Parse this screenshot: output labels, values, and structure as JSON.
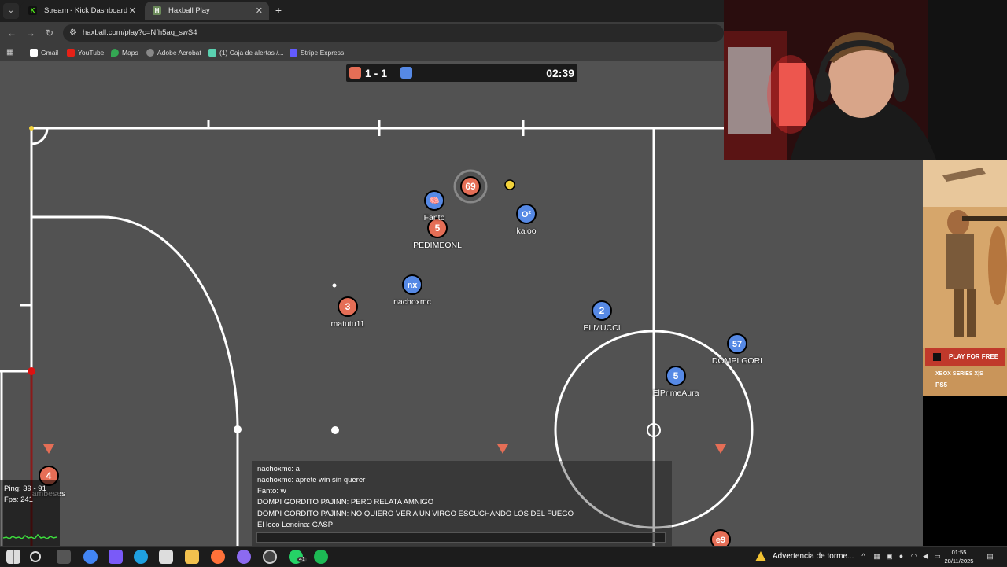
{
  "browser": {
    "tabs": [
      {
        "title": "Stream - Kick Dashboard",
        "icon": "kick-icon",
        "active": false
      },
      {
        "title": "Haxball Play",
        "icon": "haxball-icon",
        "active": true
      }
    ],
    "address": "haxball.com/play?c=Nfh5aq_swS4",
    "bookmarks": [
      "Gmail",
      "YouTube",
      "Maps",
      "Adobe Acrobat",
      "(1) Caja de alertas /...",
      "Stripe Express"
    ]
  },
  "game": {
    "score": "1 - 1",
    "time": "02:39",
    "colors": {
      "red": "#e56e56",
      "blue": "#5689e5",
      "field": "#525252"
    },
    "players": [
      {
        "team": "blue",
        "avatar": "🧠",
        "name": "Fanto"
      },
      {
        "team": "red",
        "avatar": "69",
        "name": ""
      },
      {
        "team": "blue",
        "avatar": "O²",
        "name": "kaioo"
      },
      {
        "team": "red",
        "avatar": "5",
        "name": "PEDIMEONL"
      },
      {
        "team": "blue",
        "avatar": "nx",
        "name": "nachoxmc"
      },
      {
        "team": "red",
        "avatar": "3",
        "name": "matutu11"
      },
      {
        "team": "blue",
        "avatar": "2",
        "name": "ELMUCCI"
      },
      {
        "team": "blue",
        "avatar": "57",
        "name": "DOMPI GORI"
      },
      {
        "team": "blue",
        "avatar": "5",
        "name": "ElPrimeAura"
      },
      {
        "team": "red",
        "avatar": "4",
        "name": "ambeses"
      },
      {
        "team": "red",
        "avatar": "e9",
        "name": ""
      }
    ],
    "chat": [
      "nachoxmc: a",
      "nachoxmc: aprete win sin querer",
      "Fanto: w",
      "DOMPI GORDITO PAJINN: PERO RELATA AMNIGO",
      "DOMPI GORDITO PAJINN: NO QUIERO VER A UN VIRGO ESCUCHANDO LOS DEL FUEGO",
      "El loco Lencina: GASPI"
    ],
    "stats": {
      "ping": "Ping: 39 - 91",
      "fps": "Fps: 241"
    }
  },
  "ad": {
    "cta": "PLAY FOR FREE",
    "platform_1": "XBOX SERIES X|S",
    "platform_2": "PS5"
  },
  "taskbar": {
    "weather": "Advertencia de torme...",
    "time": "01:55",
    "date": "28/11/2025",
    "whatsapp_badge": "41"
  }
}
